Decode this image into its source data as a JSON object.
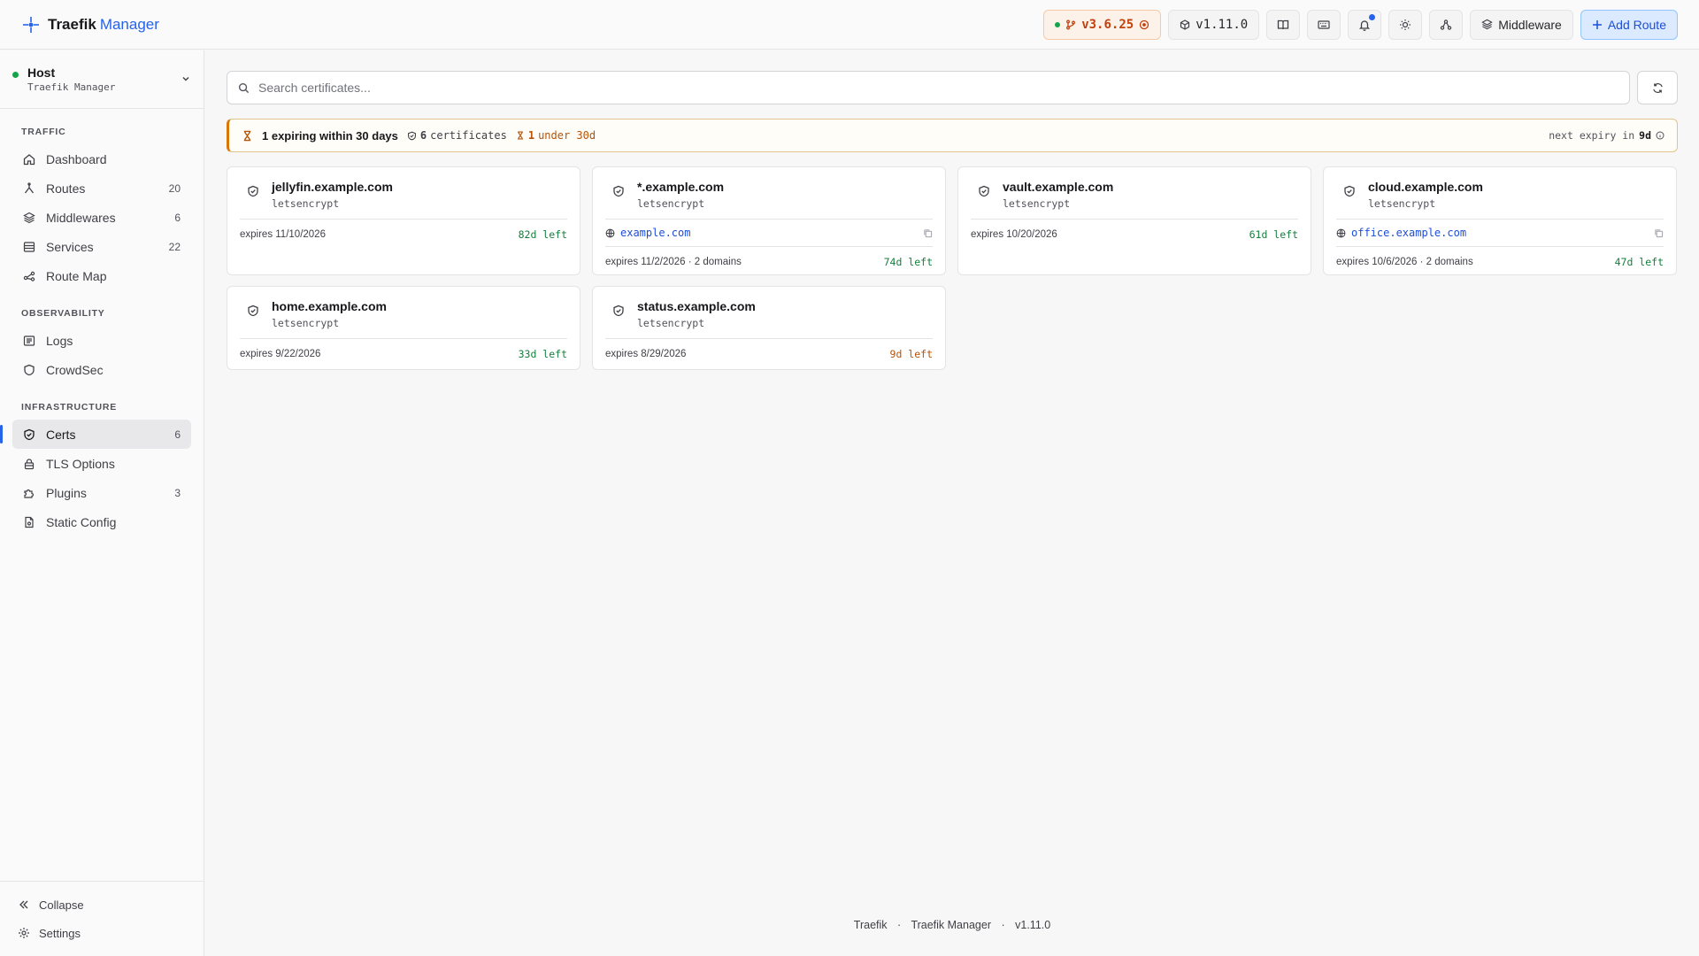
{
  "app": {
    "name_a": "Traefik",
    "name_b": "Manager"
  },
  "topbar": {
    "traefik_version": "v3.6.25",
    "manager_version": "v1.11.0",
    "middleware_label": "Middleware",
    "add_route_label": "Add Route"
  },
  "host": {
    "title": "Host",
    "subtitle": "Traefik Manager"
  },
  "sidebar": {
    "sections": {
      "traffic": "TRAFFIC",
      "observability": "OBSERVABILITY",
      "infrastructure": "INFRASTRUCTURE"
    },
    "items": {
      "dashboard": {
        "label": "Dashboard",
        "count": ""
      },
      "routes": {
        "label": "Routes",
        "count": "20"
      },
      "middlewares": {
        "label": "Middlewares",
        "count": "6"
      },
      "services": {
        "label": "Services",
        "count": "22"
      },
      "route_map": {
        "label": "Route Map",
        "count": ""
      },
      "logs": {
        "label": "Logs",
        "count": ""
      },
      "crowdsec": {
        "label": "CrowdSec",
        "count": ""
      },
      "certs": {
        "label": "Certs",
        "count": "6"
      },
      "tls_options": {
        "label": "TLS Options",
        "count": ""
      },
      "plugins": {
        "label": "Plugins",
        "count": "3"
      },
      "static_config": {
        "label": "Static Config",
        "count": ""
      }
    },
    "collapse_label": "Collapse",
    "settings_label": "Settings"
  },
  "search": {
    "placeholder": "Search certificates...",
    "value": ""
  },
  "banner": {
    "title": "1 expiring within 30 days",
    "cert_count": "6",
    "cert_label": "certificates",
    "under_count": "1",
    "under_label": "under 30d",
    "next_label": "next expiry in",
    "next_value": "9d"
  },
  "certs": [
    {
      "name": "jellyfin.example.com",
      "issuer": "letsencrypt",
      "domain": "",
      "expires": "expires 11/10/2026",
      "left": "82d left",
      "warn": false
    },
    {
      "name": "*.example.com",
      "issuer": "letsencrypt",
      "domain": "example.com",
      "expires": "expires 11/2/2026 · 2 domains",
      "left": "74d left",
      "warn": false
    },
    {
      "name": "vault.example.com",
      "issuer": "letsencrypt",
      "domain": "",
      "expires": "expires 10/20/2026",
      "left": "61d left",
      "warn": false
    },
    {
      "name": "cloud.example.com",
      "issuer": "letsencrypt",
      "domain": "office.example.com",
      "expires": "expires 10/6/2026 · 2 domains",
      "left": "47d left",
      "warn": false
    },
    {
      "name": "home.example.com",
      "issuer": "letsencrypt",
      "domain": "",
      "expires": "expires 9/22/2026",
      "left": "33d left",
      "warn": false
    },
    {
      "name": "status.example.com",
      "issuer": "letsencrypt",
      "domain": "",
      "expires": "expires 8/29/2026",
      "left": "9d left",
      "warn": true
    }
  ],
  "footer": {
    "a": "Traefik",
    "b": "Traefik Manager",
    "c": "v1.11.0",
    "sep": "·"
  },
  "colors": {
    "accent": "#2563eb",
    "warn": "#b45309",
    "ok": "#15803d"
  }
}
